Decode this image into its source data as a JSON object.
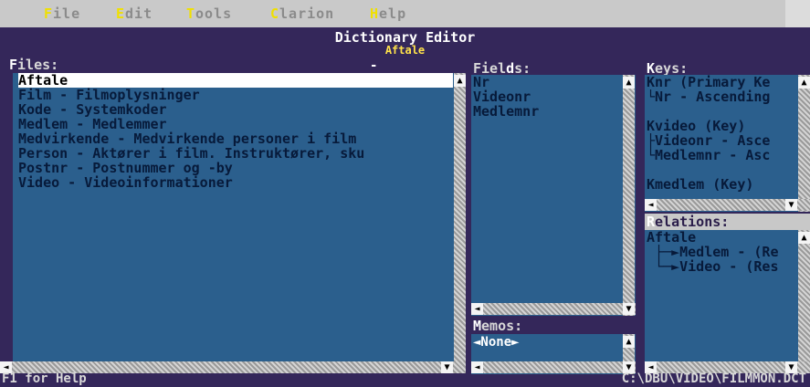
{
  "menu": {
    "items": [
      {
        "hot": "F",
        "rest": "ile"
      },
      {
        "hot": "E",
        "rest": "dit"
      },
      {
        "hot": "T",
        "rest": "ools"
      },
      {
        "hot": "C",
        "rest": "larion"
      },
      {
        "hot": "H",
        "rest": "elp"
      }
    ]
  },
  "window": {
    "title": "Dictionary Editor",
    "subtitle": "Aftale",
    "marker": "-"
  },
  "files": {
    "heading_hot": "F",
    "heading_rest": "iles:",
    "items": [
      "Aftale",
      "Film - Filmoplysninger",
      "Kode - Systemkoder",
      "Medlem - Medlemmer",
      "Medvirkende - Medvirkende personer i film",
      "Person - Aktører i film. Instruktører, sku",
      "Postnr - Postnummer og -by",
      "Video - Videoinformationer"
    ],
    "selected_index": 0
  },
  "fields": {
    "heading_pre": "Fiel",
    "heading_hot": "d",
    "heading_rest": "s:",
    "items": [
      "Nr",
      "Videonr",
      "Medlemnr"
    ]
  },
  "memos": {
    "heading_hot": "M",
    "heading_rest": "emos:",
    "value": "◄None►"
  },
  "keys": {
    "heading_hot": "K",
    "heading_rest": "eys:",
    "items": [
      "Knr (Primary Ke",
      "└Nr - Ascending",
      "",
      "Kvideo (Key)",
      "├Videonr - Asce",
      "└Medlemnr - Asc",
      "",
      "Kmedlem (Key)"
    ]
  },
  "relations": {
    "heading_hot": "R",
    "heading_rest": "elations:",
    "items": [
      "Aftale",
      " ├─►Medlem - (Re",
      " └─►Video - (Res"
    ]
  },
  "status": {
    "help": "F1 for Help",
    "path": "C:\\DBU\\VIDEO\\FILMMON.DCT"
  },
  "colors": {
    "panel": "#2b5f8d",
    "window": "#34275a",
    "hotkey_menu": "#f0e000",
    "subtitle": "#ffe24a"
  },
  "icons": [
    "scroll-up-arrow-icon",
    "scroll-down-arrow-icon",
    "scroll-left-arrow-icon",
    "scroll-right-arrow-icon"
  ]
}
